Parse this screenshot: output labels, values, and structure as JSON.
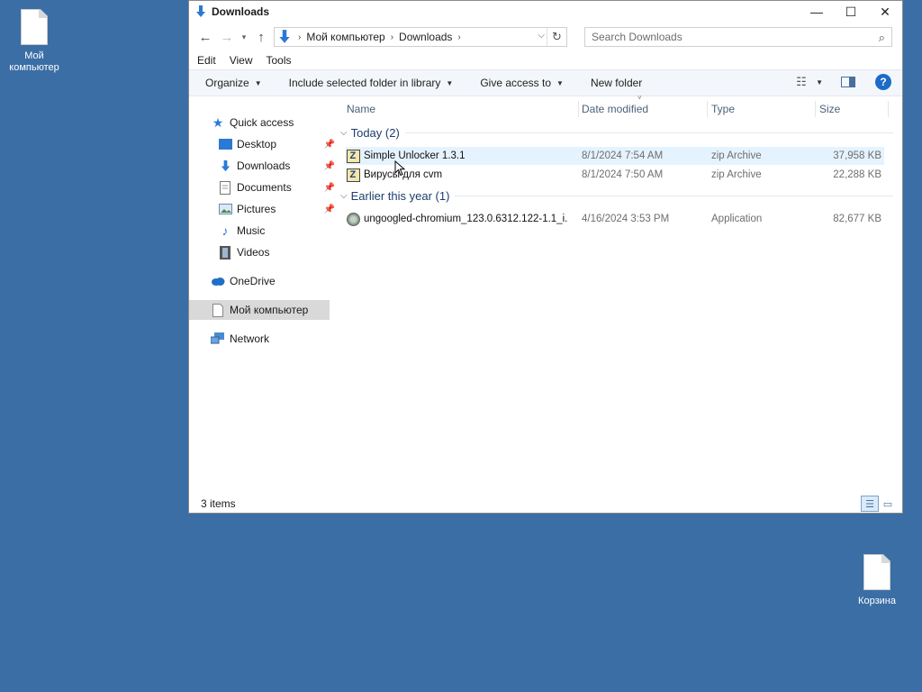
{
  "desktop": {
    "my_computer_label": "Мой компьютер",
    "recycle_label": "Корзина"
  },
  "window": {
    "title": "Downloads",
    "controls": {
      "minimize": "—",
      "maximize": "☐",
      "close": "✕"
    }
  },
  "address": {
    "crumbs": [
      "Мой компьютер",
      "Downloads"
    ],
    "search_placeholder": "Search Downloads"
  },
  "menu": [
    "Edit",
    "View",
    "Tools"
  ],
  "toolbar": {
    "organize": "Organize",
    "include_library": "Include selected folder in library",
    "give_access": "Give access to",
    "new_folder": "New folder"
  },
  "nav": {
    "quick_access": "Quick access",
    "desktop": "Desktop",
    "downloads": "Downloads",
    "documents": "Documents",
    "pictures": "Pictures",
    "music": "Music",
    "videos": "Videos",
    "onedrive": "OneDrive",
    "my_computer": "Мой компьютер",
    "network": "Network"
  },
  "columns": {
    "name": "Name",
    "date": "Date modified",
    "type": "Type",
    "size": "Size"
  },
  "groups": [
    {
      "label": "Today (2)",
      "files": [
        {
          "name": "Simple Unlocker 1.3.1",
          "date": "8/1/2024 7:54 AM",
          "type": "zip Archive",
          "size": "37,958 KB",
          "icon": "zip-icon"
        },
        {
          "name": "Вирусы для cvm",
          "date": "8/1/2024 7:50 AM",
          "type": "zip Archive",
          "size": "22,288 KB",
          "icon": "zip-icon"
        }
      ]
    },
    {
      "label": "Earlier this year (1)",
      "files": [
        {
          "name": "ungoogled-chromium_123.0.6312.122-1.1_i...",
          "date": "4/16/2024 3:53 PM",
          "type": "Application",
          "size": "82,677 KB",
          "icon": "application-icon"
        }
      ]
    }
  ],
  "status": {
    "items": "3 items"
  }
}
